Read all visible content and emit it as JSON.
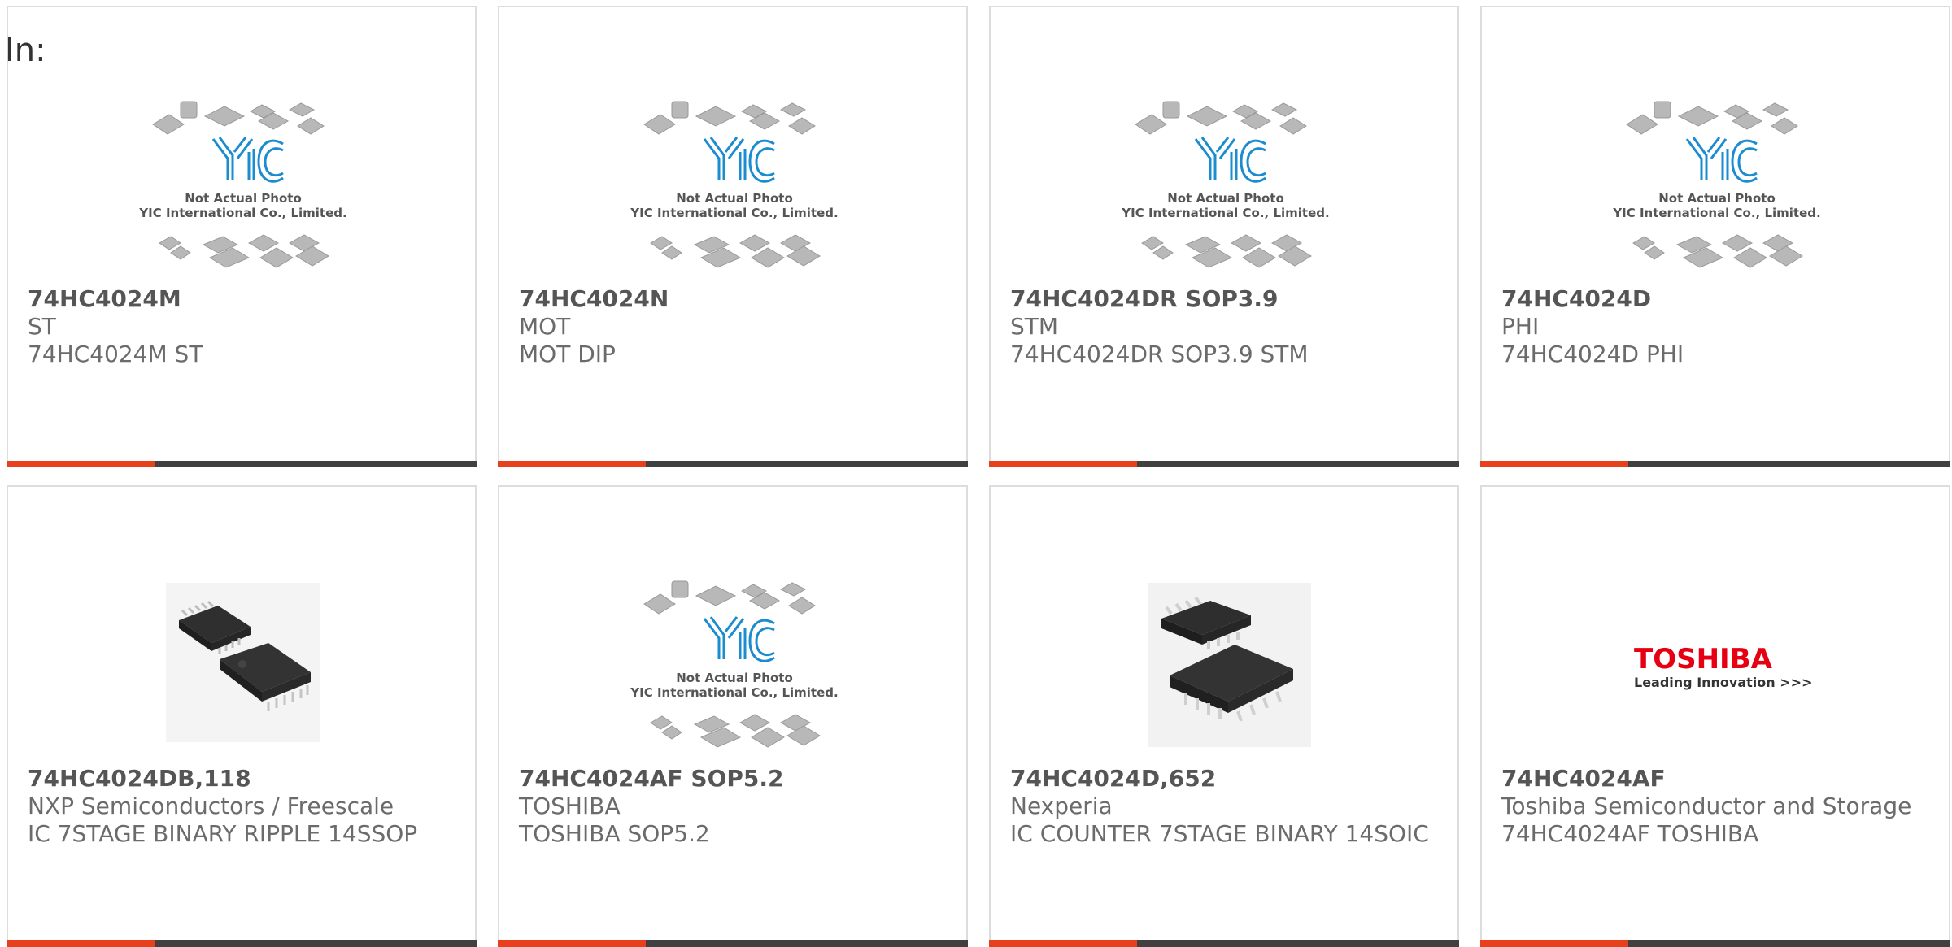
{
  "heading": "In:",
  "colors": {
    "accent": "#e8401c",
    "bar": "#404040",
    "yic_blue": "#1a8ccf",
    "toshiba_red": "#e60012"
  },
  "products": [
    {
      "part": "74HC4024M",
      "maker": "ST",
      "desc": "74HC4024M ST",
      "image": "yic-placeholder",
      "image_text": [
        "Not Actual Photo",
        "YIC International Co., Limited."
      ]
    },
    {
      "part": "74HC4024N",
      "maker": "MOT",
      "desc": "MOT DIP",
      "image": "yic-placeholder",
      "image_text": [
        "Not Actual Photo",
        "YIC International Co., Limited."
      ]
    },
    {
      "part": "74HC4024DR SOP3.9",
      "maker": "STM",
      "desc": "74HC4024DR SOP3.9 STM",
      "image": "yic-placeholder",
      "image_text": [
        "Not Actual Photo",
        "YIC International Co., Limited."
      ]
    },
    {
      "part": "74HC4024D",
      "maker": "PHI",
      "desc": "74HC4024D PHI",
      "image": "yic-placeholder",
      "image_text": [
        "Not Actual Photo",
        "YIC International Co., Limited."
      ]
    },
    {
      "part": "74HC4024DB,118",
      "maker": "NXP Semiconductors / Freescale",
      "desc": "IC 7STAGE BINARY RIPPLE 14SSOP",
      "image": "ssop-chip-photo"
    },
    {
      "part": "74HC4024AF SOP5.2",
      "maker": "TOSHIBA",
      "desc": "TOSHIBA SOP5.2",
      "image": "yic-placeholder",
      "image_text": [
        "Not Actual Photo",
        "YIC International Co., Limited."
      ]
    },
    {
      "part": "74HC4024D,652",
      "maker": "Nexperia",
      "desc": "IC COUNTER 7STAGE BINARY 14SOIC",
      "image": "soic-chip-photo"
    },
    {
      "part": "74HC4024AF",
      "maker": "Toshiba Semiconductor and Storage",
      "desc": "74HC4024AF TOSHIBA",
      "image": "toshiba-logo",
      "image_text": [
        "TOSHIBA",
        "Leading Innovation >>>"
      ]
    }
  ]
}
